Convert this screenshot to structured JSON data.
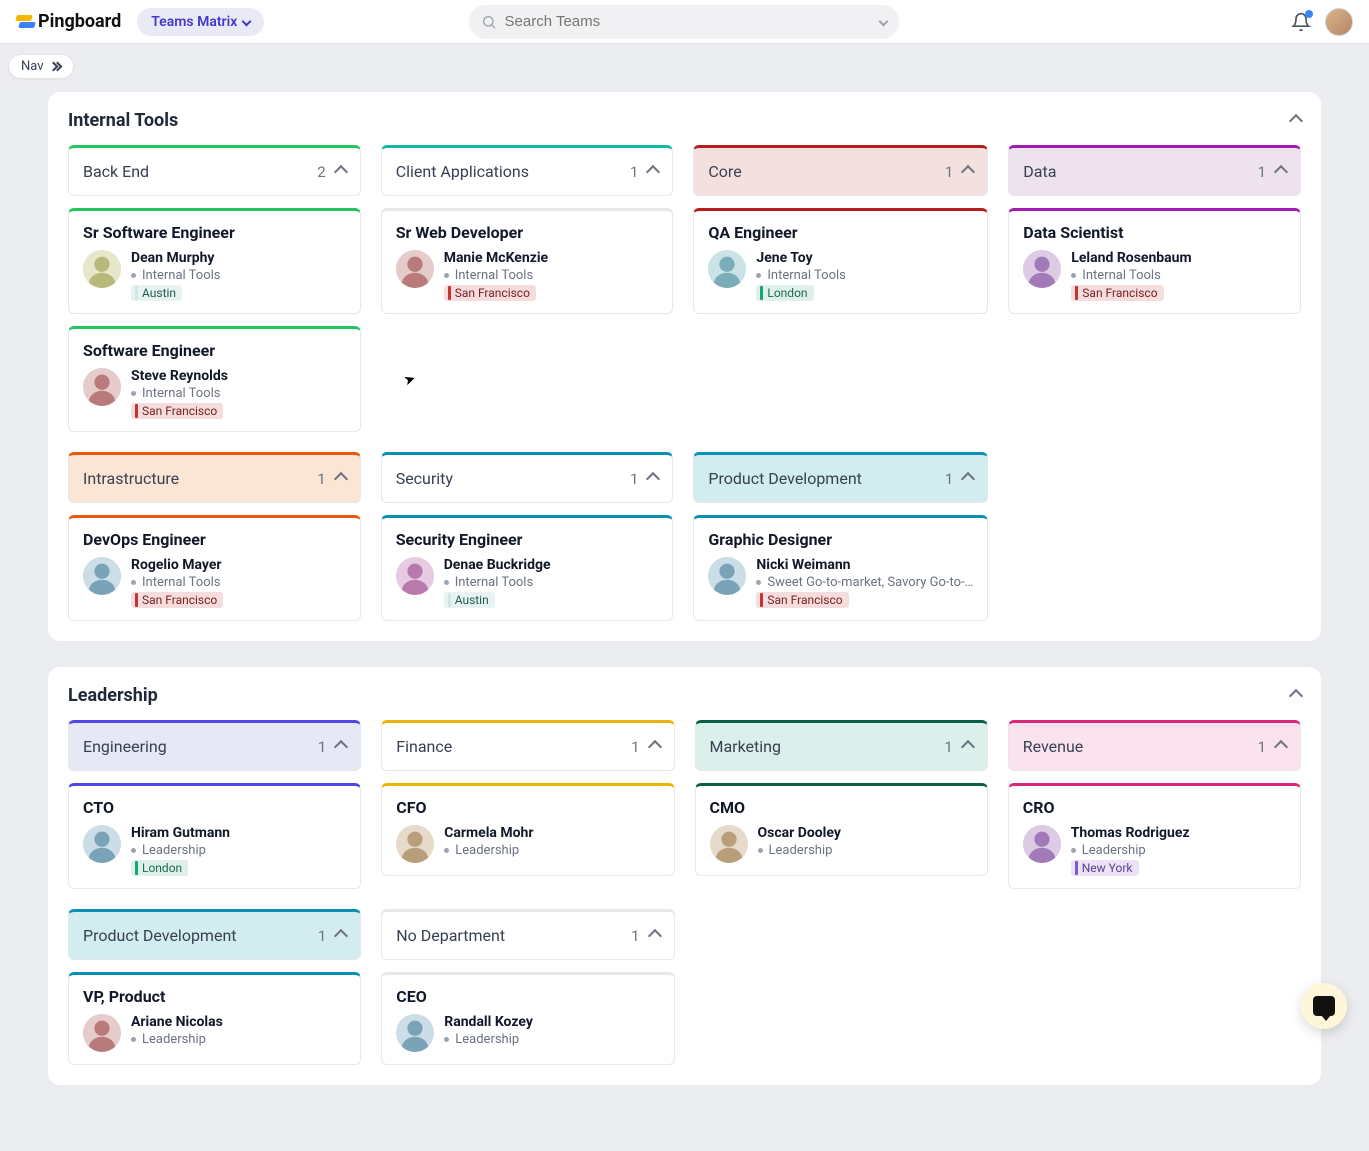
{
  "brand": "Pingboard",
  "view_switcher": "Teams Matrix",
  "search": {
    "placeholder": "Search Teams"
  },
  "nav_chip": "Nav",
  "sections": [
    {
      "title": "Internal Tools",
      "teams": [
        {
          "name": "Back End",
          "count": 2,
          "accent": "green",
          "members": [
            {
              "role": "Sr Software Engineer",
              "name": "Dean Murphy",
              "dept": "Internal Tools",
              "loc": "Austin",
              "loc_theme": "austin"
            },
            {
              "role": "Software Engineer",
              "name": "Steve Reynolds",
              "dept": "Internal Tools",
              "loc": "San Francisco",
              "loc_theme": "sf"
            }
          ]
        },
        {
          "name": "Client Applications",
          "count": 1,
          "accent": "teal",
          "members": [
            {
              "role": "Sr Web Developer",
              "name": "Manie McKenzie",
              "dept": "Internal Tools",
              "loc": "San Francisco",
              "loc_theme": "sf"
            }
          ]
        },
        {
          "name": "Core",
          "count": 1,
          "accent": "red",
          "members": [
            {
              "role": "QA Engineer",
              "name": "Jene Toy",
              "dept": "Internal Tools",
              "loc": "London",
              "loc_theme": "london"
            }
          ]
        },
        {
          "name": "Data",
          "count": 1,
          "accent": "plum",
          "members": [
            {
              "role": "Data Scientist",
              "name": "Leland Rosenbaum",
              "dept": "Internal Tools",
              "loc": "San Francisco",
              "loc_theme": "sf"
            }
          ]
        },
        {
          "name": "Intrastructure",
          "count": 1,
          "accent": "orange",
          "members": [
            {
              "role": "DevOps Engineer",
              "name": "Rogelio Mayer",
              "dept": "Internal Tools",
              "loc": "San Francisco",
              "loc_theme": "sf"
            }
          ]
        },
        {
          "name": "Security",
          "count": 1,
          "accent": "cyan",
          "members": [
            {
              "role": "Security Engineer",
              "name": "Denae Buckridge",
              "dept": "Internal Tools",
              "loc": "Austin",
              "loc_theme": "austin"
            }
          ]
        },
        {
          "name": "Product Development",
          "count": 1,
          "accent": "cyan-fill",
          "members": [
            {
              "role": "Graphic Designer",
              "name": "Nicki Weimann",
              "dept": "Sweet Go-to-market, Savory Go-to-…",
              "loc": "San Francisco",
              "loc_theme": "sf"
            }
          ]
        }
      ]
    },
    {
      "title": "Leadership",
      "teams": [
        {
          "name": "Engineering",
          "count": 1,
          "accent": "indigo",
          "members": [
            {
              "role": "CTO",
              "name": "Hiram Gutmann",
              "dept": "Leadership",
              "loc": "London",
              "loc_theme": "london"
            }
          ]
        },
        {
          "name": "Finance",
          "count": 1,
          "accent": "yellow",
          "members": [
            {
              "role": "CFO",
              "name": "Carmela Mohr",
              "dept": "Leadership"
            }
          ]
        },
        {
          "name": "Marketing",
          "count": 1,
          "accent": "darkgreen",
          "members": [
            {
              "role": "CMO",
              "name": "Oscar Dooley",
              "dept": "Leadership"
            }
          ]
        },
        {
          "name": "Revenue",
          "count": 1,
          "accent": "pink",
          "members": [
            {
              "role": "CRO",
              "name": "Thomas Rodriguez",
              "dept": "Leadership",
              "loc": "New York",
              "loc_theme": "ny"
            }
          ]
        },
        {
          "name": "Product Development",
          "count": 1,
          "accent": "cyan-fill",
          "members": [
            {
              "role": "VP, Product",
              "name": "Ariane Nicolas",
              "dept": "Leadership"
            }
          ]
        },
        {
          "name": "No Department",
          "count": 1,
          "accent": "none",
          "members": [
            {
              "role": "CEO",
              "name": "Randall Kozey",
              "dept": "Leadership"
            }
          ]
        }
      ]
    }
  ]
}
